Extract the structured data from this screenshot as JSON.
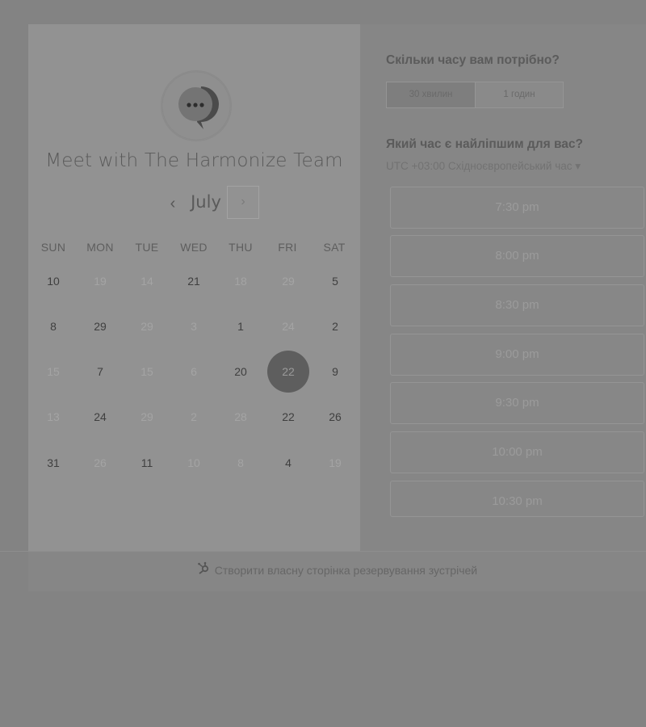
{
  "meeting_title": "Meet with The Harmonize Team",
  "avatar_icon": "chat-bubble-icon",
  "calendar": {
    "month": "July",
    "prev_icon": "‹",
    "next_icon": "›",
    "weekdays": [
      "SUN",
      "MON",
      "TUE",
      "WED",
      "THU",
      "FRI",
      "SAT"
    ],
    "weeks": [
      [
        {
          "d": "10",
          "s": "available"
        },
        {
          "d": "19",
          "s": "unavailable"
        },
        {
          "d": "14",
          "s": "unavailable"
        },
        {
          "d": "21",
          "s": "available"
        },
        {
          "d": "18",
          "s": "unavailable"
        },
        {
          "d": "29",
          "s": "unavailable"
        },
        {
          "d": "5",
          "s": "available"
        }
      ],
      [
        {
          "d": "8",
          "s": "available"
        },
        {
          "d": "29",
          "s": "available"
        },
        {
          "d": "29",
          "s": "unavailable"
        },
        {
          "d": "3",
          "s": "unavailable"
        },
        {
          "d": "1",
          "s": "available"
        },
        {
          "d": "24",
          "s": "unavailable"
        },
        {
          "d": "2",
          "s": "available"
        }
      ],
      [
        {
          "d": "15",
          "s": "unavailable"
        },
        {
          "d": "7",
          "s": "available"
        },
        {
          "d": "15",
          "s": "unavailable"
        },
        {
          "d": "6",
          "s": "unavailable"
        },
        {
          "d": "20",
          "s": "available"
        },
        {
          "d": "22",
          "s": "selected"
        },
        {
          "d": "9",
          "s": "available"
        }
      ],
      [
        {
          "d": "13",
          "s": "unavailable"
        },
        {
          "d": "24",
          "s": "available"
        },
        {
          "d": "29",
          "s": "unavailable"
        },
        {
          "d": "2",
          "s": "unavailable"
        },
        {
          "d": "28",
          "s": "unavailable"
        },
        {
          "d": "22",
          "s": "available"
        },
        {
          "d": "26",
          "s": "available"
        }
      ],
      [
        {
          "d": "31",
          "s": "available"
        },
        {
          "d": "26",
          "s": "unavailable"
        },
        {
          "d": "11",
          "s": "available"
        },
        {
          "d": "10",
          "s": "unavailable"
        },
        {
          "d": "8",
          "s": "unavailable"
        },
        {
          "d": "4",
          "s": "available"
        },
        {
          "d": "19",
          "s": "unavailable"
        }
      ]
    ]
  },
  "duration": {
    "question": "Скільки часу вам потрібно?",
    "options": [
      "30 хвилин",
      "1 годин"
    ],
    "selected_index": 0
  },
  "time": {
    "question": "Який час є найліпшим для вас?",
    "timezone": "UTC +03:00 Східноєвропейський час ▾",
    "slots": [
      "7:30 pm",
      "8:00 pm",
      "8:30 pm",
      "9:00 pm",
      "9:30 pm",
      "10:00 pm",
      "10:30 pm"
    ]
  },
  "footer": {
    "icon": "hubspot-sprocket-icon",
    "text": "Створити власну сторінка резервування зустрічей"
  }
}
